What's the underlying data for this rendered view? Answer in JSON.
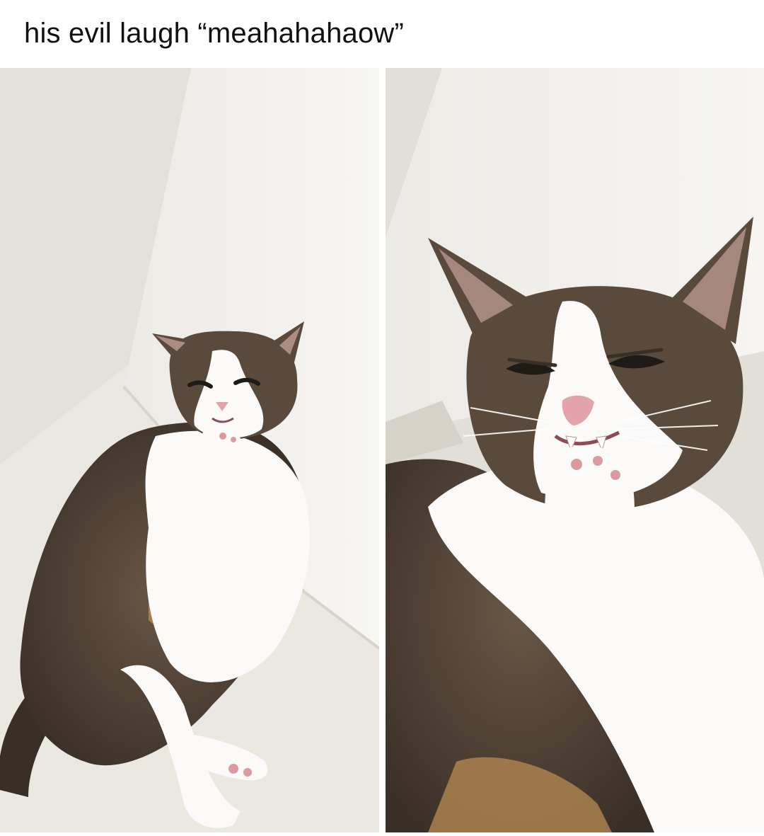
{
  "caption": {
    "text": "his evil laugh “meahahahaow”"
  },
  "photos": [
    {
      "subject": "tabby-and-white cat lounging on a white sofa, paw raised to mouth, evil grin",
      "view": "full-body"
    },
    {
      "subject": "tabby-and-white cat lounging on a white sofa, paw raised to mouth, evil grin",
      "view": "close-up"
    }
  ],
  "colors": {
    "background": "#ffffff",
    "sofa": "#e9e6df",
    "cushion": "#f4f3ef",
    "fur_white": "#fbfaf8",
    "fur_tabby": "#5a4a3c",
    "fur_dark": "#2e2620",
    "fur_orange": "#b08650",
    "nose": "#e3a3aa",
    "paw_pads": "#d99aa0"
  }
}
